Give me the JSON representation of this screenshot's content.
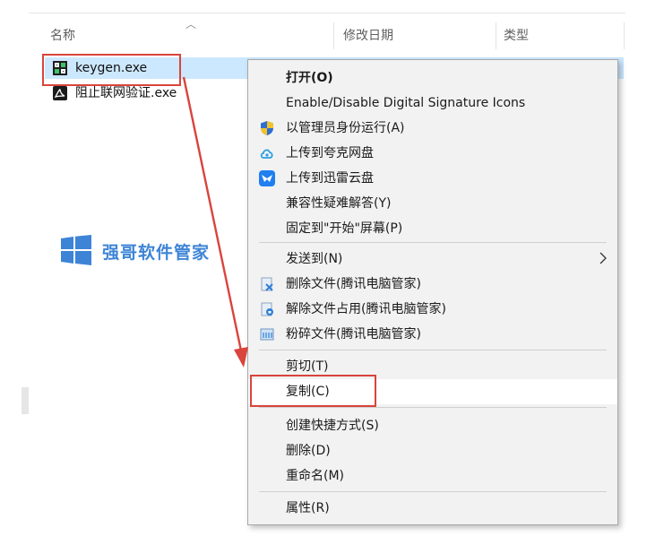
{
  "columns": {
    "name": "名称",
    "modified": "修改日期",
    "type": "类型"
  },
  "files": [
    {
      "name": "keygen.exe",
      "icon": "keygen-app-icon",
      "selected": true
    },
    {
      "name": "阻止联网验证.exe",
      "icon": "acrobat-app-icon",
      "selected": false
    }
  ],
  "watermark": {
    "text": "强哥软件管家",
    "icon": "windows-logo-icon"
  },
  "context_menu": {
    "items": [
      {
        "label": "打开(O)",
        "bold": true
      },
      {
        "label": "Enable/Disable Digital Signature Icons"
      },
      {
        "label": "以管理员身份运行(A)",
        "icon": "uac-shield-icon"
      },
      {
        "label": "上传到夸克网盘",
        "icon": "quark-cloud-icon"
      },
      {
        "label": "上传到迅雷云盘",
        "icon": "xunlei-icon"
      },
      {
        "label": "兼容性疑难解答(Y)"
      },
      {
        "label": "固定到\"开始\"屏幕(P)"
      },
      {
        "label": "发送到(N)",
        "submenu": true
      },
      {
        "label": "删除文件(腾讯电脑管家)",
        "icon": "tencent-delete-icon"
      },
      {
        "label": "解除文件占用(腾讯电脑管家)",
        "icon": "tencent-unlock-icon"
      },
      {
        "label": "粉碎文件(腾讯电脑管家)",
        "icon": "tencent-shred-icon"
      },
      {
        "label": "剪切(T)"
      },
      {
        "label": "复制(C)",
        "highlighted": true
      },
      {
        "label": "创建快捷方式(S)"
      },
      {
        "label": "删除(D)"
      },
      {
        "label": "重命名(M)"
      },
      {
        "label": "属性(R)"
      }
    ]
  },
  "colors": {
    "accent_red": "#d9443c",
    "selection": "#cce8ff",
    "menu_bg": "#f2f2f2",
    "watermark_blue": "#3d84d6"
  }
}
